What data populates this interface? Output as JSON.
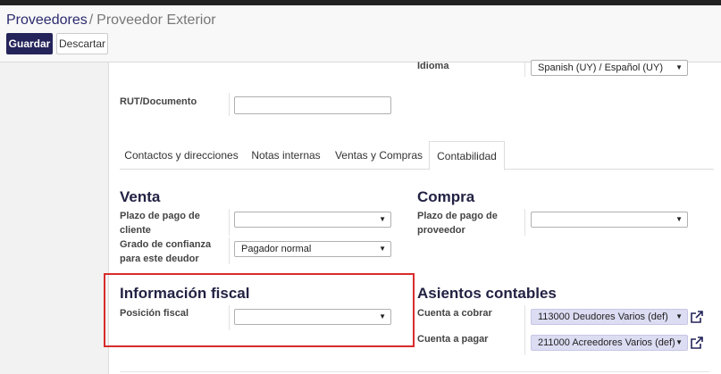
{
  "breadcrumb": {
    "parent": "Proveedores",
    "separator": "/",
    "current": "Proveedor Exterior"
  },
  "buttons": {
    "save": "Guardar",
    "discard": "Descartar"
  },
  "header": {
    "idioma_label": "Idioma",
    "idioma_value": "Spanish (UY) / Español (UY)",
    "rut_label": "RUT/Documento",
    "rut_value": ""
  },
  "tabs": [
    {
      "label": "Contactos y direcciones",
      "active": false
    },
    {
      "label": "Notas internas",
      "active": false
    },
    {
      "label": "Ventas y Compras",
      "active": false
    },
    {
      "label": "Contabilidad",
      "active": true
    }
  ],
  "venta": {
    "title": "Venta",
    "plazo_label": "Plazo de pago de cliente",
    "plazo_value": "",
    "grado_label": "Grado de confianza para este deudor",
    "grado_value": "Pagador normal"
  },
  "compra": {
    "title": "Compra",
    "plazo_label": "Plazo de pago de proveedor",
    "plazo_value": ""
  },
  "fiscal": {
    "title": "Información fiscal",
    "posicion_label": "Posición fiscal",
    "posicion_value": ""
  },
  "asientos": {
    "title": "Asientos contables",
    "cobrar_label": "Cuenta a cobrar",
    "cobrar_value": "113000 Deudores Varios (def)",
    "pagar_label": "Cuenta a pagar",
    "pagar_value": "211000 Acreedores Varios (def)"
  },
  "icons": {
    "dropdown": "caret-down-icon",
    "external": "external-link-icon"
  },
  "colors": {
    "primary": "#24245a",
    "highlight": "#d92b2b",
    "many2one_bg": "#dcdcf3"
  }
}
